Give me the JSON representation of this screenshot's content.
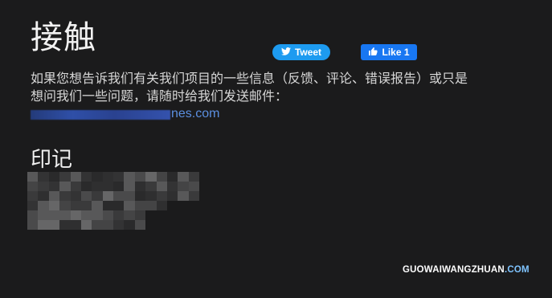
{
  "page": {
    "title": "接触",
    "intro_line1": "如果您想告诉我们有关我们项目的一些信息（反馈、评论、错误报告）或只是",
    "intro_line2": "想问我们一些问题，请随时给我们发送邮件：",
    "email_visible_suffix": "nes.com",
    "subtitle": "印记"
  },
  "social": {
    "tweet_label": "Tweet",
    "tweet_icon": "twitter-bird-icon",
    "like_label": "Like 1",
    "like_icon": "thumbs-up-icon"
  },
  "watermark": {
    "text_main": "GUOWAIWANGZHUAN",
    "text_suffix": ".COM"
  },
  "colors": {
    "background": "#1b1b1c",
    "tweet_button": "#1d9bf0",
    "like_button": "#1877f2",
    "link": "#5b8fe0"
  }
}
